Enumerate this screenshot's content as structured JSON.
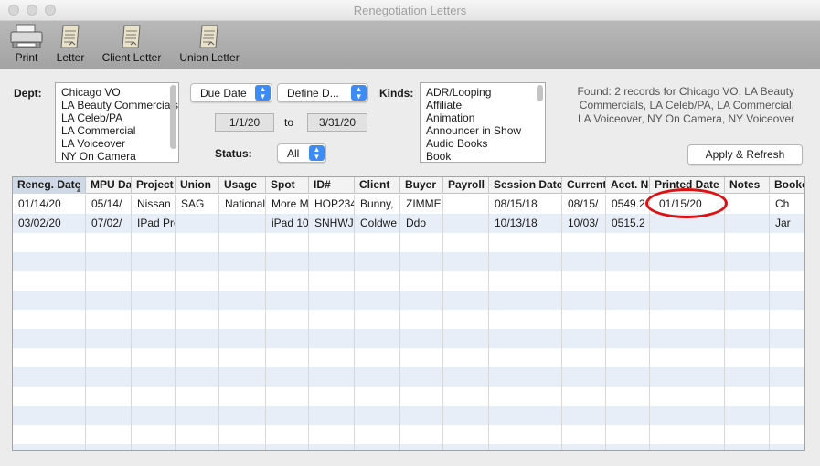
{
  "window": {
    "title": "Renegotiation Letters"
  },
  "toolbar": {
    "items": [
      {
        "label": "Print",
        "icon": "printer-icon"
      },
      {
        "label": "Letter",
        "icon": "letter-icon"
      },
      {
        "label": "Client Letter",
        "icon": "client-letter-icon"
      },
      {
        "label": "Union Letter",
        "icon": "union-letter-icon"
      }
    ]
  },
  "filters": {
    "dept_label": "Dept:",
    "dept_items": [
      "Chicago VO",
      "LA Beauty Commercials",
      "LA Celeb/PA",
      "LA Commercial",
      "LA Voiceover",
      "NY On Camera"
    ],
    "date_field_popup": "Due Date",
    "date_range_popup": "Define D...",
    "date_from": "1/1/20",
    "date_to_label": "to",
    "date_to": "3/31/20",
    "status_label": "Status:",
    "status_popup": "All",
    "kinds_label": "Kinds:",
    "kinds_items": [
      "ADR/Looping",
      "Affiliate",
      "Animation",
      "Announcer in Show",
      "Audio Books",
      "Book"
    ],
    "found_text": "Found: 2 records for Chicago VO, LA Beauty Commercials, LA Celeb/PA, LA Commercial, LA Voiceover, NY On Camera, NY Voiceover",
    "apply_button": "Apply & Refresh"
  },
  "table": {
    "columns": [
      "Reneg. Date",
      "MPU Date",
      "Project",
      "Union",
      "Usage",
      "Spot",
      "ID#",
      "Client",
      "Buyer",
      "Payroll",
      "Session Date",
      "Current",
      "Acct. No",
      "Printed Date",
      "Notes",
      "Booker"
    ],
    "rows": [
      [
        "01/14/20",
        "05/14/",
        "Nissan",
        "SAG",
        "National",
        "More M",
        "HOP234",
        "Bunny,",
        "ZIMMER",
        "",
        "08/15/18",
        "08/15/",
        "0549.2",
        "01/15/20",
        "",
        "Ch"
      ],
      [
        "03/02/20",
        "07/02/",
        "IPad Pro",
        "",
        "",
        "iPad 10",
        "SNHWJN",
        "Coldwe",
        "Ddo",
        "",
        "10/13/18",
        "10/03/",
        "0515.2",
        "",
        "",
        "Jar"
      ]
    ]
  },
  "colors": {
    "accent": "#3d8bf5",
    "highlight_circle": "#e01010",
    "row_stripe": "#e8eef7"
  }
}
